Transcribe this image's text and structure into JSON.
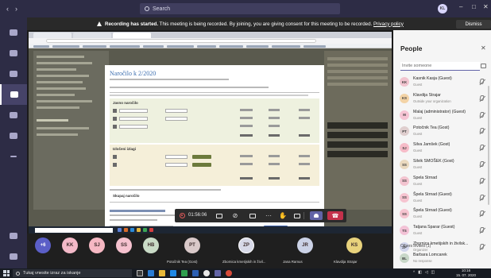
{
  "titlebar": {
    "search_placeholder": "Search",
    "me_initials": "KL",
    "window_controls": [
      "–",
      "□",
      "✕"
    ]
  },
  "banner": {
    "bold": "Recording has started.",
    "text": " This meeting is being recorded. By joining, you are giving consent for this meeting to be recorded.",
    "link": "Privacy policy",
    "dismiss": "Dismiss"
  },
  "shared_screen": {
    "modal_title": "Naročilo k 2/2020",
    "sections": [
      "Javno naročilo",
      "Izločeni izlagi",
      "Skupaj naročilo"
    ]
  },
  "callbar": {
    "duration": "01:56:06"
  },
  "participants_strip": [
    {
      "initials": "+6",
      "color": "#5b5fc7",
      "label": ""
    },
    {
      "initials": "KK",
      "color": "#f3b9c8",
      "label": ""
    },
    {
      "initials": "SJ",
      "color": "#f6b8c3",
      "label": ""
    },
    {
      "initials": "SS",
      "color": "#f6c2cf",
      "label": ""
    },
    {
      "initials": "HB",
      "color": "#c9dbc6",
      "label": ""
    },
    {
      "initials": "PT",
      "color": "#d9c9c9",
      "label": "Potočnik Tea (Gost)"
    },
    {
      "initials": "ZP",
      "color": "#d7d9e8",
      "label": "Zbornica kmetijskih in živil..."
    },
    {
      "initials": "JR",
      "color": "#cbd2e6",
      "label": "Jana Ramus"
    },
    {
      "initials": "KS",
      "color": "#e8d27c",
      "label": "Klavdija Strajar"
    }
  ],
  "people_panel": {
    "title": "People",
    "invite_placeholder": "Invite someone",
    "people": [
      {
        "initials": "KK",
        "name": "Kasnik Kasja (Guest)",
        "role": "Guest",
        "color": "#f1c4cf"
      },
      {
        "initials": "KS",
        "name": "Klavdija Strajar",
        "role": "Outside your organization",
        "color": "#f3d3a6"
      },
      {
        "initials": "M",
        "name": "Malaj (administrator) (Guest)",
        "role": "Guest",
        "color": "#f6c4d4"
      },
      {
        "initials": "PT",
        "name": "Potočnik Tea (Gost)",
        "role": "Guest",
        "color": "#dfcece"
      },
      {
        "initials": "SJ",
        "name": "Silva Jamšek (Gost)",
        "role": "Guest",
        "color": "#f6bcc8"
      },
      {
        "initials": "SS",
        "name": "Silvik SMOŠEK (Gost)",
        "role": "Guest",
        "color": "#ead9bf"
      },
      {
        "initials": "SS",
        "name": "Spela Strnad",
        "role": "Guest",
        "color": "#f3c4d0"
      },
      {
        "initials": "SS",
        "name": "Špela Strnad (Guest)",
        "role": "Guest",
        "color": "#f6c4d0"
      },
      {
        "initials": "SS",
        "name": "Špela Strnad (Guest)",
        "role": "Guest",
        "color": "#f6c4d0"
      },
      {
        "initials": "TS",
        "name": "Tatjana Sparar (Guest)",
        "role": "Guest",
        "color": "#f3c2d6"
      },
      {
        "initials": "ZP",
        "name": "Zbornica kmetijskih in živilsk...",
        "role": "Organizer",
        "color": "#d2d6ec"
      }
    ],
    "others_header": "Others invited (1)",
    "others": [
      {
        "initials": "BL",
        "name": "Barbara Lomcarek",
        "role": "No response",
        "color": "#c8d7c8"
      }
    ]
  },
  "taskbar": {
    "search_placeholder": "Tukaj vnesite izraz za iskanje",
    "time": "10:16",
    "date": "15. 07. 2020"
  }
}
